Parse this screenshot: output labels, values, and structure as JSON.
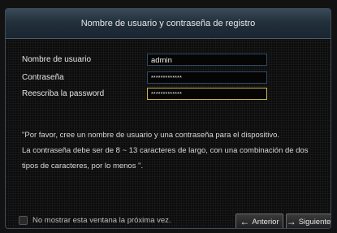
{
  "dialog": {
    "title": "Nombre de usuario y contraseña de registro"
  },
  "form": {
    "username_label": "Nombre de usuario",
    "username_value": "admin",
    "password_label": "Contraseña",
    "password_value": "*************",
    "confirm_label": "Reescriba la password",
    "confirm_value": "*************"
  },
  "message": {
    "line1": "\"Por favor, cree un nombre de usuario y una contraseña para el dispositivo.",
    "line2": "La contraseña debe ser de 8 ~ 13 caracteres de largo, con una combinación de dos",
    "line3": "tipos de caracteres, por lo menos \"."
  },
  "footer": {
    "checkbox_label": "No mostrar esta ventana la próxima vez.",
    "checkbox_checked": false,
    "prev_label": "Anterior",
    "prev_icon": "arrow-left-icon",
    "next_label": "Siguiente",
    "next_icon": "arrow-right-icon"
  },
  "colors": {
    "title_bar": "#2a3844",
    "focus_border": "#c7b44a",
    "field_border": "#2f4a66"
  }
}
